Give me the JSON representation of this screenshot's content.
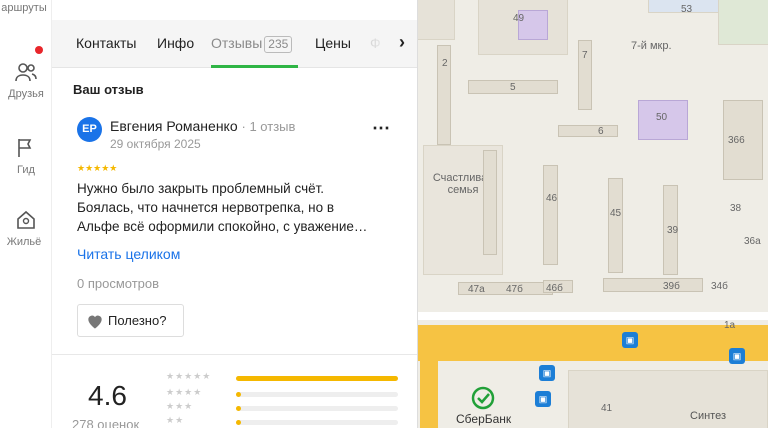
{
  "rail": {
    "items": [
      {
        "label": "аршруты",
        "icon": "route-icon"
      },
      {
        "label": "Друзья",
        "icon": "friends-icon"
      },
      {
        "label": "Гид",
        "icon": "flag-icon"
      },
      {
        "label": "Жильё",
        "icon": "house-icon"
      }
    ]
  },
  "tabs": {
    "items": [
      "Контакты",
      "Инфо",
      "Отзывы",
      "Цены",
      "Ф"
    ],
    "reviews_count": "235",
    "active": "Отзывы"
  },
  "review": {
    "section_title": "Ваш отзыв",
    "avatar_initials": "ЕР",
    "author": "Евгения Романенко",
    "author_meta": "1 отзыв",
    "date": "29 октября 2025",
    "stars": "★★★★★",
    "rating": 5,
    "text_line1": "Нужно было закрыть проблемный счёт.",
    "text_line2": "Боялась, что начнется нервотрепка, но в",
    "text_line3": "Альфе всё оформили спокойно, с уважение…",
    "read_more": "Читать целиком",
    "views": "0 просмотров",
    "useful_label": "Полезно?"
  },
  "summary": {
    "rating": "4.6",
    "count": "278 оценок",
    "distribution": [
      {
        "stars": "★★★★★",
        "fraction": 1.0
      },
      {
        "stars": "★★★★",
        "fraction": 0.03
      },
      {
        "stars": "★★★",
        "fraction": 0.03
      },
      {
        "stars": "★★",
        "fraction": 0.03
      }
    ]
  },
  "map": {
    "labels": [
      "49",
      "53",
      "7-й мкр.",
      "2",
      "7",
      "5",
      "50",
      "6",
      "366",
      "Счастливая семья",
      "46",
      "45",
      "39",
      "38",
      "36а",
      "47а",
      "47б",
      "46б",
      "39б",
      "34б",
      "1а",
      "41",
      "Синтез",
      "СберБанк"
    ],
    "colors": {
      "accent_road": "#f6c343",
      "bank": "#21a038",
      "transit": "#1c7ed6"
    }
  }
}
